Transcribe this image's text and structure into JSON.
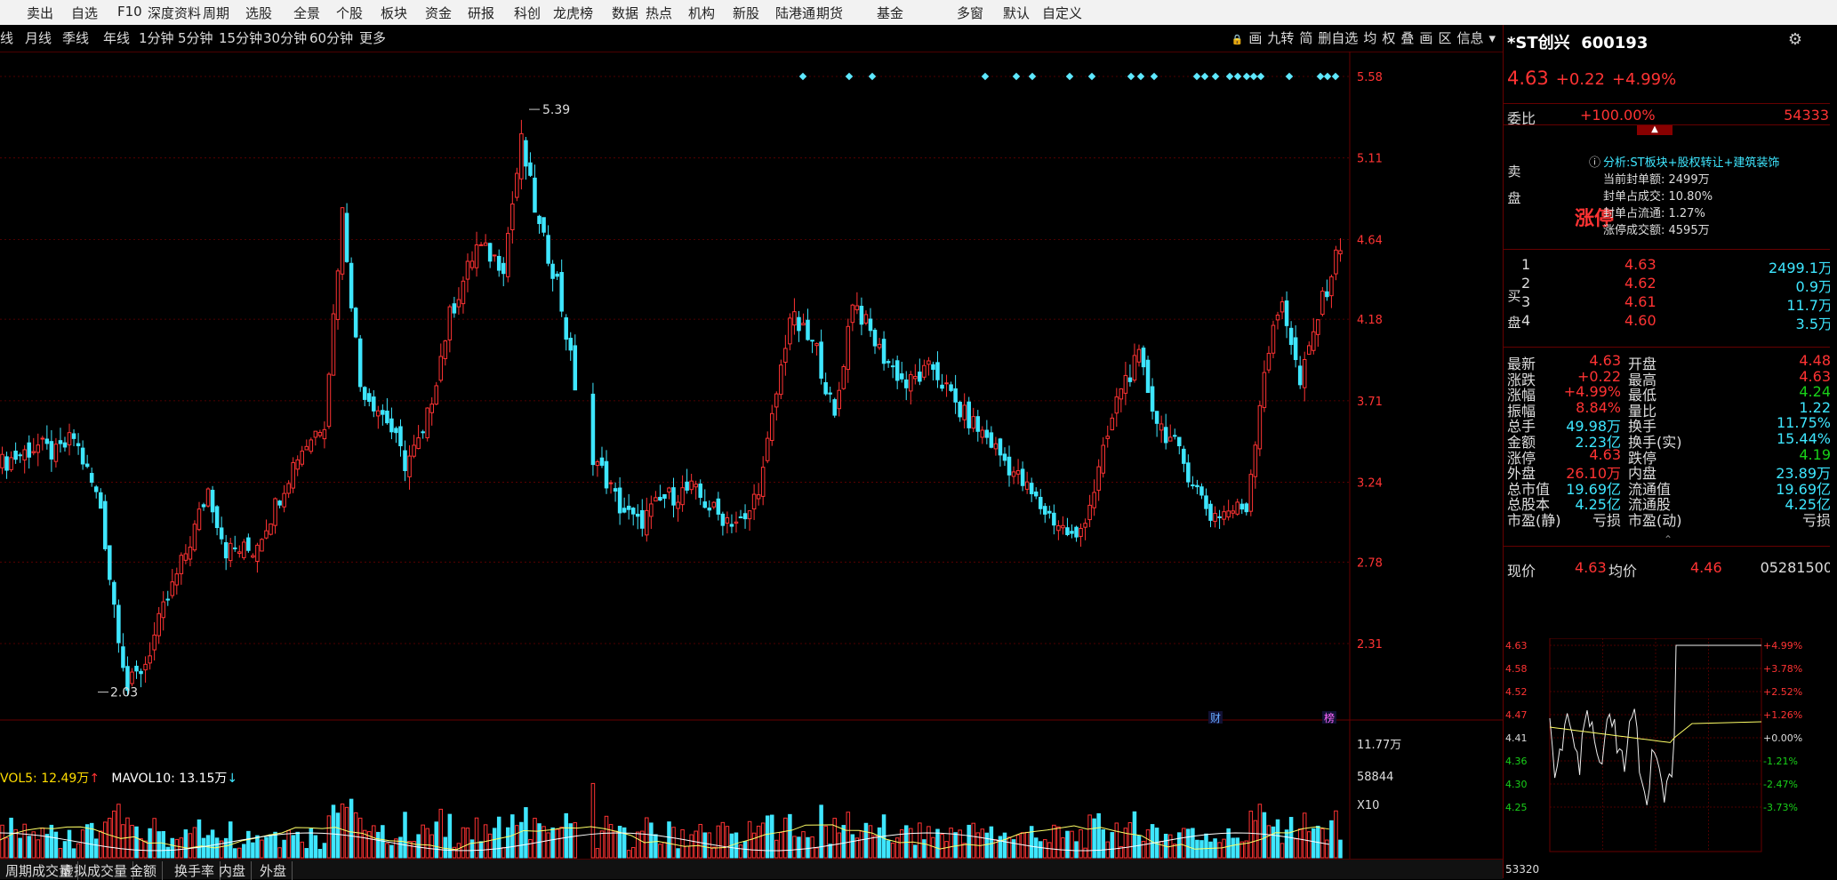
{
  "top_menu": [
    "卖出",
    "自选",
    "F10",
    "深度资料",
    "周期",
    "选股",
    "全景",
    "个股",
    "板块",
    "资金",
    "研报",
    "科创",
    "龙虎榜",
    "数据",
    "热点",
    "机构",
    "新股",
    "陆港通",
    "期货",
    "基金",
    "多窗",
    "默认",
    "自定义"
  ],
  "toolbar": {
    "periods": [
      "线",
      "月线",
      "季线",
      "年线",
      "1分钟",
      "5分钟",
      "15分钟",
      "30分钟",
      "60分钟",
      "更多"
    ],
    "tools": [
      "画",
      "九转",
      "简",
      "删自选",
      "均",
      "权",
      "叠",
      "画",
      "区",
      "信息"
    ]
  },
  "stock": {
    "name": "*ST创兴",
    "code": "600193",
    "price": "4.63",
    "change": "+0.22",
    "pct": "+4.99%"
  },
  "chart_data": {
    "type": "candlestick",
    "y_ticks": [
      "5.58",
      "5.11",
      "4.64",
      "4.18",
      "3.71",
      "3.24",
      "2.78",
      "2.31"
    ],
    "annotations": [
      {
        "label": "5.39"
      },
      {
        "label": "2.03"
      }
    ],
    "flags": [
      "财",
      "榜"
    ]
  },
  "volume": {
    "vol5_label": "VOL5: 12.49万",
    "vol5_arrow": "↑",
    "mavol10_label": "MAVOL10: 13.15万",
    "mavol10_arrow": "↓",
    "y_labels": [
      "11.77万",
      "58844",
      "X10"
    ]
  },
  "bottom_tabs": [
    "周期成交量",
    "虚拟成交量",
    "金额",
    "换手率",
    "内盘",
    "外盘"
  ],
  "orderbook": {
    "weibi_label": "委比",
    "weibi_value": "+100.00%",
    "weibi_diff": "54333",
    "sell_label": [
      "卖",
      "盘"
    ],
    "buy_label": [
      "买",
      "盘"
    ],
    "limit_text": "涨停",
    "analysis": [
      "分析:ST板块+股权转让+建筑装饰",
      "当前封单额: 2499万",
      "封单占成交: 10.80%",
      "封单占流通: 1.27%",
      "涨停成交额: 4595万"
    ],
    "buys": [
      {
        "level": "1",
        "price": "4.63",
        "vol": "2499.1万"
      },
      {
        "level": "2",
        "price": "4.62",
        "vol": "0.9万"
      },
      {
        "level": "3",
        "price": "4.61",
        "vol": "11.7万"
      },
      {
        "level": "4",
        "price": "4.60",
        "vol": "3.5万"
      }
    ]
  },
  "stats": [
    [
      "最新",
      "4.63",
      "开盘",
      "4.48"
    ],
    [
      "涨跌",
      "+0.22",
      "最高",
      "4.63"
    ],
    [
      "涨幅",
      "+4.99%",
      "最低",
      "4.24"
    ],
    [
      "振幅",
      "8.84%",
      "量比",
      "1.22"
    ],
    [
      "总手",
      "49.98万",
      "换手",
      "11.75%"
    ],
    [
      "金额",
      "2.23亿",
      "换手(实)",
      "15.44%"
    ],
    [
      "涨停",
      "4.63",
      "跌停",
      "4.19"
    ],
    [
      "外盘",
      "26.10万",
      "内盘",
      "23.89万"
    ],
    [
      "总市值",
      "19.69亿",
      "流通值",
      "19.69亿"
    ],
    [
      "总股本",
      "4.25亿",
      "流通股",
      "4.25亿"
    ],
    [
      "市盈(静)",
      "亏损",
      "市盈(动)",
      "亏损"
    ]
  ],
  "intraday": {
    "xianjia_label": "现价",
    "xianjia": "4.63",
    "junjia_label": "均价",
    "junjia": "4.46",
    "time_code": "05281500",
    "price_ticks": [
      "4.63",
      "4.58",
      "4.52",
      "4.47",
      "4.41",
      "4.36",
      "4.30",
      "4.25"
    ],
    "pct_ticks": [
      "+4.99%",
      "+3.78%",
      "+2.52%",
      "+1.26%",
      "+0.00%",
      "-1.21%",
      "-2.47%",
      "-3.73%"
    ],
    "vol_label": "53320"
  },
  "colors": {
    "up": "#ff3333",
    "down": "#3ee6ff",
    "grid": "#660000",
    "ma": "#ffff66"
  }
}
